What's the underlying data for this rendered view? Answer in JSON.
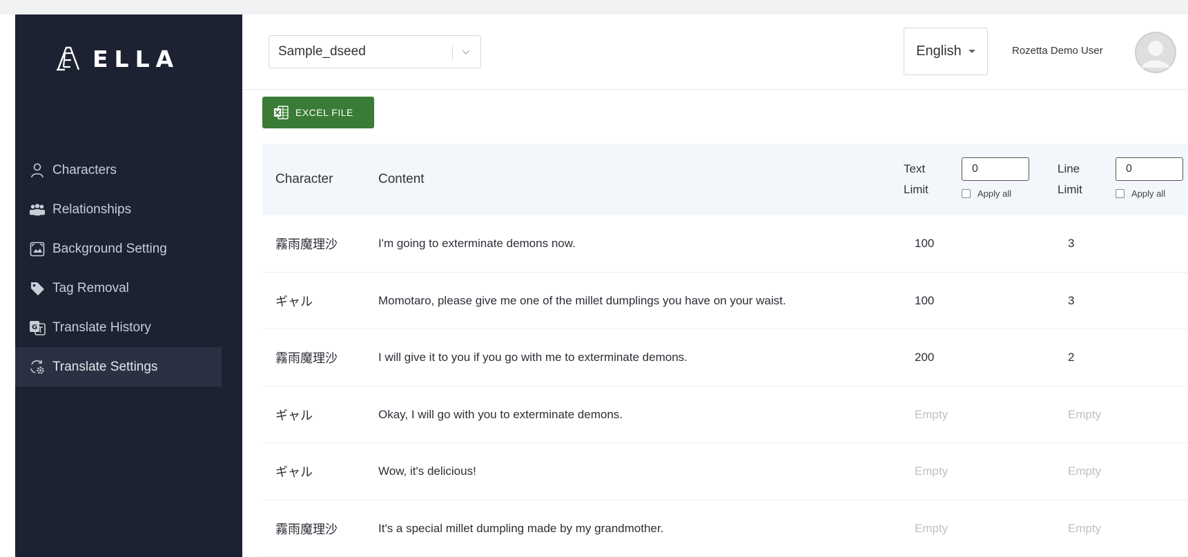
{
  "app": {
    "logo_text": "ELLA"
  },
  "sidebar": {
    "items": [
      {
        "label": "Characters",
        "icon": "user-icon"
      },
      {
        "label": "Relationships",
        "icon": "people-icon"
      },
      {
        "label": "Background Setting",
        "icon": "image-frame-icon"
      },
      {
        "label": "Tag Removal",
        "icon": "tag-icon"
      },
      {
        "label": "Translate History",
        "icon": "translate-icon"
      },
      {
        "label": "Translate Settings",
        "icon": "gear-translate-icon",
        "active": true
      }
    ]
  },
  "header": {
    "project_select": "Sample_dseed",
    "language": "English",
    "user_name": "Rozetta Demo User"
  },
  "toolbar": {
    "excel_label": "EXCEL FILE"
  },
  "table": {
    "columns": {
      "character": "Character",
      "content": "Content",
      "text_limit_line1": "Text",
      "text_limit_line2": "Limit",
      "line_limit_line1": "Line",
      "line_limit_line2": "Limit"
    },
    "text_limit_value": "0",
    "line_limit_value": "0",
    "apply_all_label": "Apply all",
    "rows": [
      {
        "character": "霧雨魔理沙",
        "content": "I'm going to exterminate demons now.",
        "text_limit": "100",
        "line_limit": "3"
      },
      {
        "character": "ギャル",
        "content": "Momotaro, please give me one of the millet dumplings you have on your waist.",
        "text_limit": "100",
        "line_limit": "3"
      },
      {
        "character": "霧雨魔理沙",
        "content": "I will give it to you if you go with me to exterminate demons.",
        "text_limit": "200",
        "line_limit": "2"
      },
      {
        "character": "ギャル",
        "content": "Okay, I will go with you to exterminate demons.",
        "text_limit": "Empty",
        "line_limit": "Empty"
      },
      {
        "character": "ギャル",
        "content": "Wow, it's delicious!",
        "text_limit": "Empty",
        "line_limit": "Empty"
      },
      {
        "character": "霧雨魔理沙",
        "content": "It's a special millet dumpling made by my grandmother.",
        "text_limit": "Empty",
        "line_limit": "Empty"
      }
    ]
  },
  "colors": {
    "sidebar_bg": "#1c2232",
    "sidebar_active_bg": "#2a3142",
    "excel_green": "#3a7b35",
    "table_header_bg": "#f3f6fa",
    "empty_text": "#bcc0c6"
  }
}
